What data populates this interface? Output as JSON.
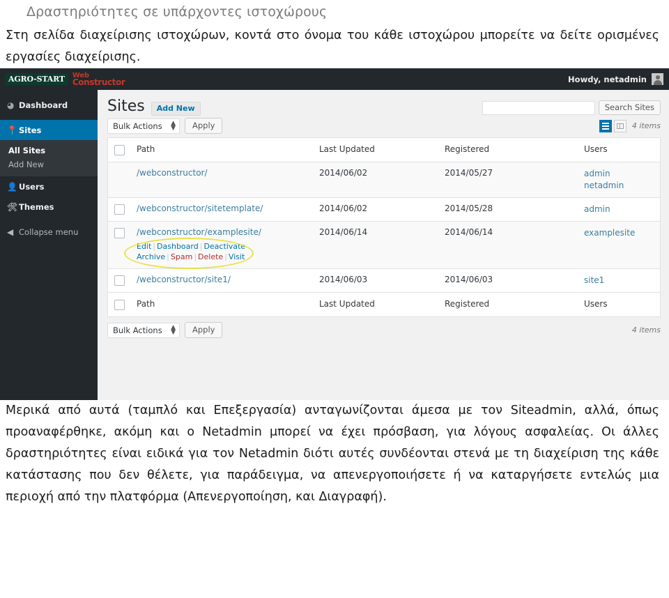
{
  "document": {
    "title": "Δραστηριότητες σε υπάρχοντες ιστοχώρους",
    "intro": "Στη σελίδα διαχείρισης ιστοχώρων, κοντά στο όνομα του κάθε ιστοχώρου μπορείτε να δείτε ορισμένες εργασίες διαχείρισης.",
    "body": "Μερικά από αυτά (ταμπλό και Επεξεργασία) ανταγωνίζονται άμεσα με τον Siteadmin, αλλά, όπως προαναφέρθηκε, ακόμη και ο Netadmin μπορεί να έχει πρόσβαση, για λόγους ασφαλείας. Οι άλλες δραστηριότητες είναι ειδικά για τον Netadmin διότι αυτές συνδέονται στενά με τη διαχείριση της κάθε κατάστασης που δεν θέλετε, για παράδειγμα, να απενεργοποιήσετε ή να καταργήσετε εντελώς μια περιοχή από την πλατφόρμα (Απενεργοποίηση, και Διαγραφή)."
  },
  "screenshot": {
    "adminbar": {
      "logo_badge": "AGRO-START",
      "logo_word1": "Web",
      "logo_word2": "Constructor",
      "howdy": "Howdy, netadmin",
      "avatar_icon": "user-avatar-icon"
    },
    "sidebar": {
      "items": [
        {
          "label": "Dashboard",
          "icon": "dashboard-icon",
          "active": false
        },
        {
          "label": "Sites",
          "icon": "pin-icon",
          "active": true
        },
        {
          "label": "Users",
          "icon": "users-icon",
          "active": false
        },
        {
          "label": "Themes",
          "icon": "brush-icon",
          "active": false
        },
        {
          "label": "Collapse menu",
          "icon": "collapse-arrow-icon",
          "active": false
        }
      ],
      "submenu": [
        {
          "label": "All Sites",
          "current": true
        },
        {
          "label": "Add New",
          "current": false
        }
      ]
    },
    "page": {
      "title": "Sites",
      "add_new": "Add New",
      "search_value": "",
      "search_placeholder": "",
      "search_button": "Search Sites",
      "bulk_actions": "Bulk Actions",
      "apply": "Apply",
      "items_count": "4 items",
      "view_list_icon": "list-view-icon",
      "view_excerpt_icon": "excerpt-view-icon"
    },
    "table": {
      "columns": [
        "Path",
        "Last Updated",
        "Registered",
        "Users"
      ],
      "rows": [
        {
          "checkbox": false,
          "path": "/webconstructor/",
          "last_updated": "2014/06/02",
          "registered": "2014/05/27",
          "users": [
            "admin",
            "netadmin"
          ],
          "actions": [],
          "highlighted": false
        },
        {
          "checkbox": true,
          "path": "/webconstructor/sitetemplate/",
          "last_updated": "2014/06/02",
          "registered": "2014/05/28",
          "users": [
            "admin"
          ],
          "actions": [],
          "highlighted": false
        },
        {
          "checkbox": true,
          "path": "/webconstructor/examplesite/",
          "last_updated": "2014/06/14",
          "registered": "2014/06/14",
          "users": [
            "examplesite"
          ],
          "actions": [
            {
              "label": "Edit",
              "danger": false
            },
            {
              "label": "Dashboard",
              "danger": false
            },
            {
              "label": "Deactivate",
              "danger": false
            },
            {
              "label": "Archive",
              "danger": false
            },
            {
              "label": "Spam",
              "danger": true
            },
            {
              "label": "Delete",
              "danger": true
            },
            {
              "label": "Visit",
              "danger": false
            }
          ],
          "highlighted": true
        },
        {
          "checkbox": true,
          "path": "/webconstructor/site1/",
          "last_updated": "2014/06/03",
          "registered": "2014/06/03",
          "users": [
            "site1"
          ],
          "actions": [],
          "highlighted": false
        }
      ]
    },
    "colors": {
      "adminbar_bg": "#23282d",
      "accent_blue": "#0073aa",
      "link_blue": "#3a7d9e",
      "danger_red": "#b32d2e",
      "highlight_yellow": "#e8e24a",
      "logo_green": "#0d3b2e",
      "logo_red": "#c0392b"
    }
  }
}
